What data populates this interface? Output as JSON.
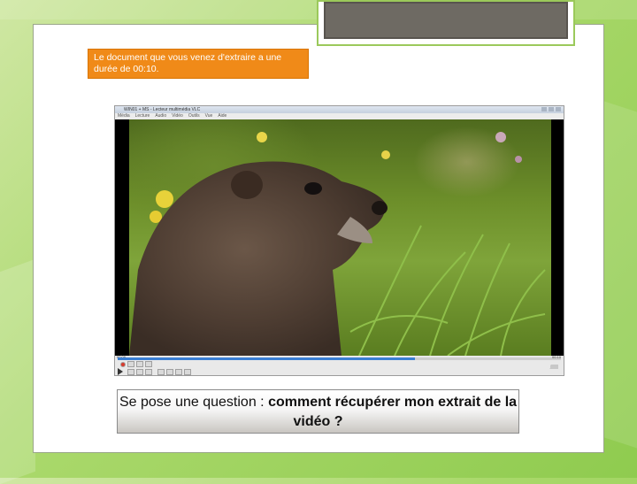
{
  "callout": {
    "text": "Le document que vous venez d'extraire a une durée de 00:10."
  },
  "vlc": {
    "title": "WIN01 + MS - Lecteur multimédia VLC",
    "menu": [
      "Média",
      "Lecture",
      "Audio",
      "Vidéo",
      "Outils",
      "Vue",
      "Aide"
    ],
    "time_elapsed": "00:09",
    "time_total": "00:10",
    "progress": 0.67,
    "video_subject": "marmot-in-meadow"
  },
  "question": {
    "prefix": "Se pose une question : ",
    "emphasis": "comment récupérer mon extrait de la vidéo ?"
  },
  "colors": {
    "callout_bg": "#f08a18",
    "background_green": "#a9d86a",
    "accent_border": "#9bc95b"
  }
}
